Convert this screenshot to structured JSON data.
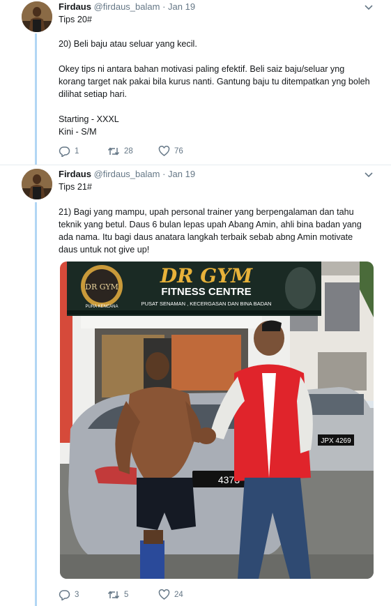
{
  "tweets": [
    {
      "author_name": "Firdaus",
      "handle": "@firdaus_balam",
      "separator": "·",
      "date": "Jan 19",
      "title_line": "Tips 20#",
      "paragraph1": "20) Beli baju atau seluar yang kecil.",
      "paragraph2": "Okey tips ni antara bahan motivasi paling efektif. Beli saiz baju/seluar yng korang target nak pakai bila kurus nanti. Gantung baju tu ditempatkan yng boleh dilihat setiap hari.",
      "paragraph3": "Starting - XXXL\nKini - S/M",
      "replies": "1",
      "retweets": "28",
      "likes": "76"
    },
    {
      "author_name": "Firdaus",
      "handle": "@firdaus_balam",
      "separator": "·",
      "date": "Jan 19",
      "title_line": "Tips 21#",
      "paragraph1": "21) Bagi yang mampu, upah personal trainer yang berpengalaman dan tahu teknik yang betul. Daus 6 bulan lepas upah Abang Amin, ahli bina badan yang ada nama. Itu bagi daus anatara langkah terbaik sebab abng Amin motivate daus untuk not give up!",
      "replies": "3",
      "retweets": "5",
      "likes": "24"
    }
  ],
  "photo": {
    "gym_name": "DR GYM",
    "fitness_line": "FITNESS CENTRE",
    "sub_line": "PUSAT SENAMAN , KECERGASAN DAN BINA BADAN",
    "logo_text": "DR GYM",
    "logo_sub": "PURA KENCANA",
    "plate_left": "4373",
    "plate_right": "JPX 4269"
  },
  "colors": {
    "thread_line": "#b2d6f4",
    "secondary_text": "#657786",
    "jacket_red": "#e0242b"
  }
}
